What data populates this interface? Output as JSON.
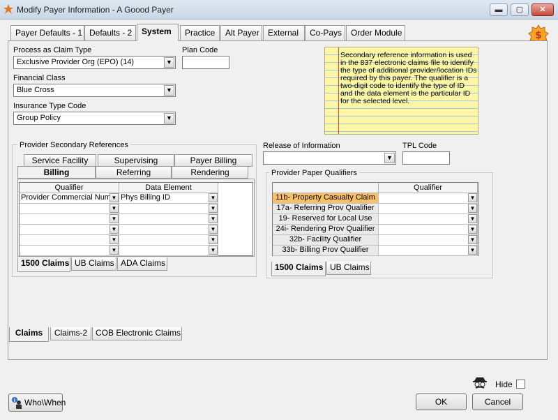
{
  "window": {
    "title": "Modify Payer Information - A Goood Payer",
    "min": "▬",
    "max": "▢",
    "close": "✕"
  },
  "tabs": [
    "Payer Defaults - 1",
    "Defaults - 2",
    "System",
    "Practice",
    "Alt Payer",
    "External",
    "Co-Pays",
    "Order Module"
  ],
  "active_tab": "System",
  "fields": {
    "process_claim_type_label": "Process as Claim Type",
    "process_claim_type_value": "Exclusive Provider Org (EPO)  (14)",
    "plan_code_label": "Plan Code",
    "plan_code_value": "",
    "financial_class_label": "Financial Class",
    "financial_class_value": "Blue Cross",
    "insurance_type_label": "Insurance Type Code",
    "insurance_type_value": "Group Policy",
    "release_info_label": "Release of Information",
    "release_info_value": "",
    "tpl_code_label": "TPL Code",
    "tpl_code_value": ""
  },
  "note": "Secondary reference information is used in the 837 electronic claims file to identify the type of additional provider/location IDs required by this payer.  The qualifier is a two-digit code to identify the type of ID and the data element is the particular ID for the selected level.",
  "provider_secondary": {
    "title": "Provider Secondary References",
    "tabs_row1": [
      "Service Facility",
      "Supervising",
      "Payer Billing"
    ],
    "tabs_row2": [
      "Billing",
      "Referring",
      "Rendering"
    ],
    "active": "Billing",
    "headers": [
      "Qualifier",
      "Data Element"
    ],
    "rows": [
      [
        "Provider Commercial Numl",
        "Phys Billing ID"
      ],
      [
        "",
        ""
      ],
      [
        "",
        ""
      ],
      [
        "",
        ""
      ],
      [
        "",
        ""
      ],
      [
        "",
        ""
      ]
    ],
    "bottom_tabs": [
      "1500 Claims",
      "UB Claims",
      "ADA Claims"
    ],
    "bottom_active": "1500 Claims"
  },
  "paper_qualifiers": {
    "title": "Provider Paper Qualifiers",
    "header": "Qualifier",
    "rows": [
      "11b- Property Casualty Claim",
      "17a- Referring Prov Qualifier",
      "19- Reserved for Local Use",
      "24i- Rendering Prov Qualifier",
      "32b- Facility Qualifier",
      "33b- Billing Prov Qualifier"
    ],
    "selected": 0,
    "bottom_tabs": [
      "1500 Claims",
      "UB Claims"
    ],
    "bottom_active": "1500 Claims"
  },
  "claims_tabs": [
    "Claims",
    "Claims-2",
    "COB Electronic Claims"
  ],
  "claims_active": "Claims",
  "footer": {
    "who_when": "Who\\When",
    "hide_label": "Hide",
    "ok": "OK",
    "cancel": "Cancel"
  },
  "colors": {
    "note_bg": "#fdf6a4",
    "selected_row": "#f9c06a",
    "accent_orange": "#e8761c"
  }
}
